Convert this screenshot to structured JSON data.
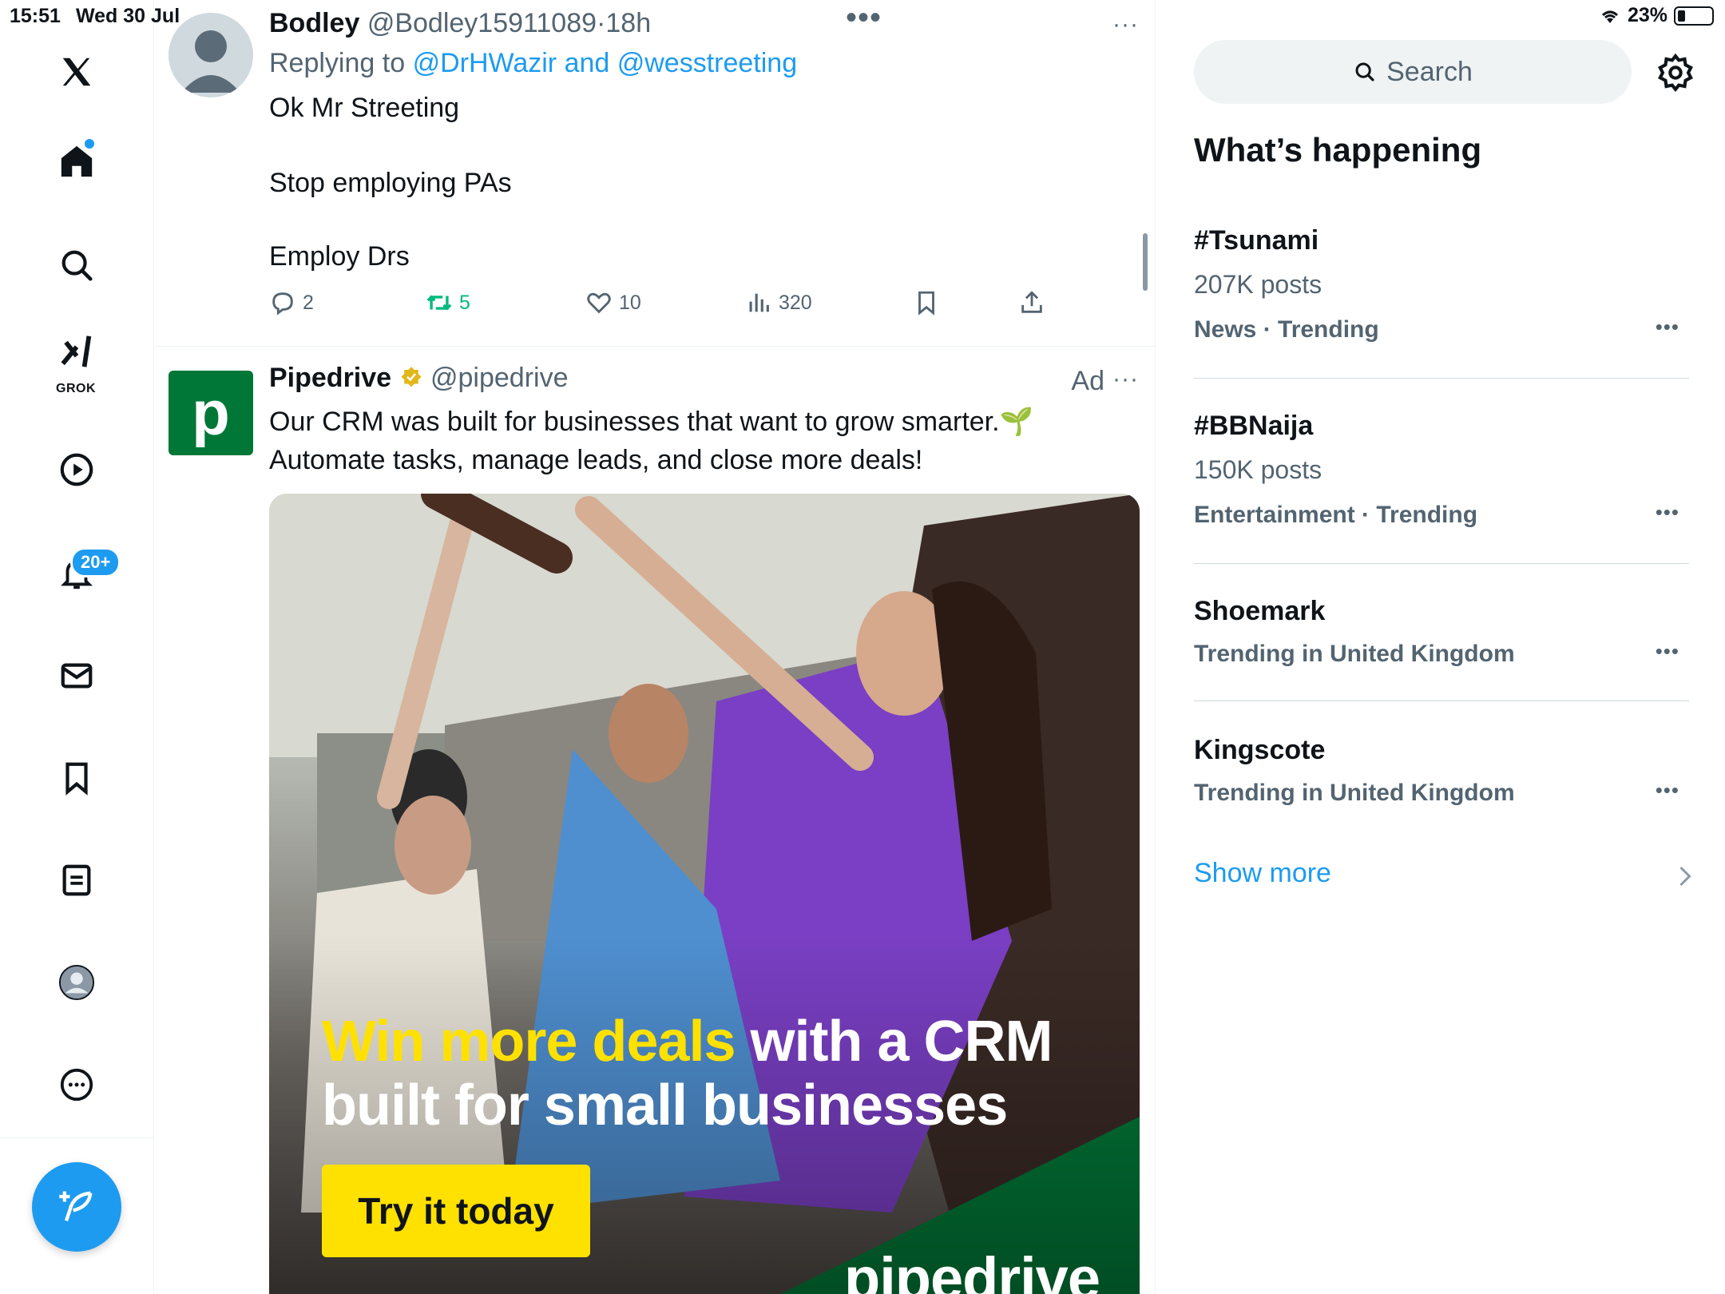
{
  "status_bar": {
    "time": "15:51",
    "date": "Wed 30 Jul",
    "battery": "23%",
    "battery_level": 0.23
  },
  "nav": {
    "notifications_badge": "20+",
    "grok_label": "GROK",
    "items": [
      "x-logo",
      "home",
      "search",
      "grok",
      "videos",
      "notifications",
      "messages",
      "bookmarks",
      "lists",
      "profile",
      "more"
    ]
  },
  "tweet": {
    "name": "Bodley",
    "handle": "@Bodley15911089",
    "separator": "·",
    "time": "18h",
    "replying_prefix": "Replying to",
    "replying_to": "@DrHWazir and @wesstreeting",
    "lines": [
      "Ok Mr Streeting",
      "Stop employing PAs",
      "Employ Drs"
    ],
    "replies": "2",
    "retweets": "5",
    "likes": "10",
    "views": "320"
  },
  "ad": {
    "name": "Pipedrive",
    "handle": "@pipedrive",
    "ad_label": "Ad",
    "logo_letter": "p",
    "text_line1": "Our CRM was built for businesses that want to grow smarter.🌱",
    "text_line2": "Automate tasks, manage leads, and close more deals!",
    "headline_highlight": "Win more deals",
    "headline_rest": " with a CRM",
    "headline_line2": "built for small businesses",
    "cta": "Try it today",
    "wordmark": "pipedrive"
  },
  "right": {
    "search_placeholder": "Search",
    "section_title": "What’s happening",
    "trends": [
      {
        "title": "#Tsunami",
        "posts": "207K posts",
        "meta": "News · Trending"
      },
      {
        "title": "#BBNaija",
        "posts": "150K posts",
        "meta": "Entertainment · Trending"
      },
      {
        "title": "Shoemark",
        "posts": "",
        "meta": "Trending in United Kingdom"
      },
      {
        "title": "Kingscote",
        "posts": "",
        "meta": "Trending in United Kingdom"
      }
    ],
    "show_more": "Show more"
  },
  "colors": {
    "accent": "#1d9bf0",
    "retweet": "#00ba7c",
    "brand_green": "#017737",
    "cta_yellow": "#ffe100"
  }
}
